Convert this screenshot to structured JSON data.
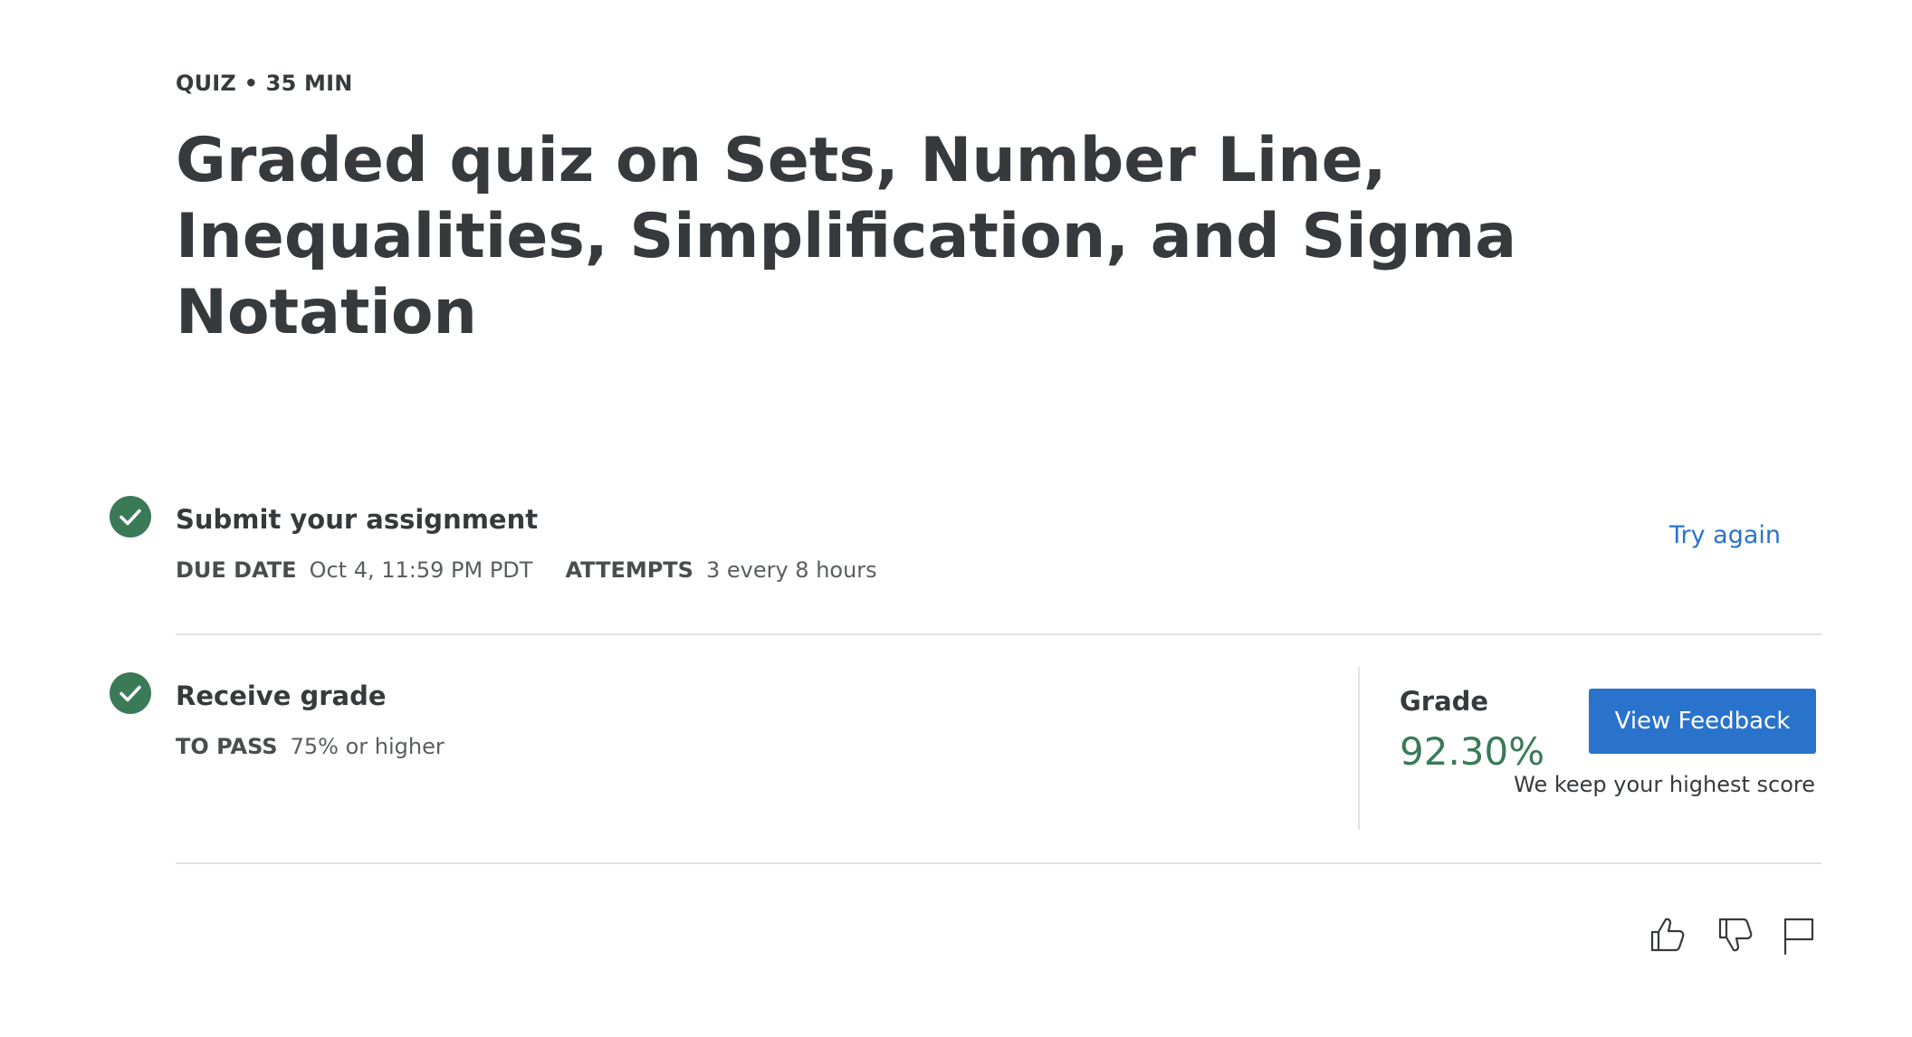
{
  "header": {
    "eyebrow": "QUIZ • 35 MIN",
    "title": "Graded quiz on Sets, Number Line, Inequalities, Simplification, and Sigma Notation"
  },
  "submit": {
    "title": "Submit your assignment",
    "due_label": "DUE DATE",
    "due_value": "Oct 4, 11:59 PM PDT",
    "attempts_label": "ATTEMPTS",
    "attempts_value": "3 every 8 hours",
    "try_again": "Try again"
  },
  "receive": {
    "title": "Receive grade",
    "pass_label": "TO PASS",
    "pass_value": "75% or higher"
  },
  "grade": {
    "label": "Grade",
    "value": "92.30%",
    "button": "View Feedback",
    "note": "We keep your highest score"
  },
  "icons": {
    "complete": "check-circle-icon",
    "like": "thumbs-up-icon",
    "dislike": "thumbs-down-icon",
    "report": "flag-icon"
  },
  "colors": {
    "accent": "#2a73cc",
    "success": "#3b7a57",
    "text": "#373a3c",
    "divider": "#e3e3e3"
  }
}
